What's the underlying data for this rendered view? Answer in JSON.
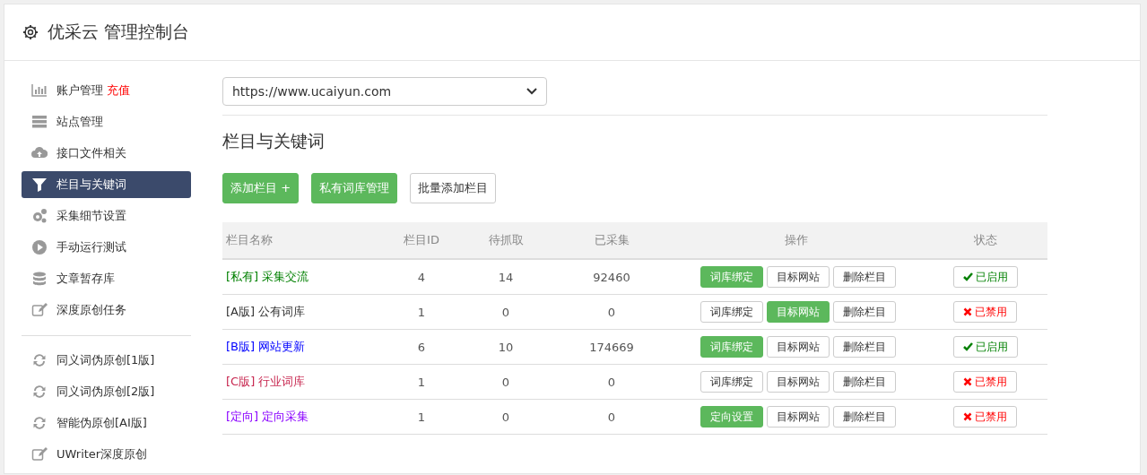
{
  "header": {
    "title": "优采云 管理控制台"
  },
  "sidebar": {
    "groups": [
      {
        "items": [
          {
            "label": "账户管理",
            "badge": "充值",
            "selected": false
          },
          {
            "label": "站点管理",
            "selected": false
          },
          {
            "label": "接口文件相关",
            "selected": false
          },
          {
            "label": "栏目与关键词",
            "selected": true
          },
          {
            "label": "采集细节设置",
            "selected": false
          },
          {
            "label": "手动运行测试",
            "selected": false
          },
          {
            "label": "文章暂存库",
            "selected": false
          },
          {
            "label": "深度原创任务",
            "selected": false
          }
        ]
      },
      {
        "items": [
          {
            "label": "同义词伪原创[1版]",
            "selected": false
          },
          {
            "label": "同义词伪原创[2版]",
            "selected": false
          },
          {
            "label": "智能伪原创[AI版]",
            "selected": false
          },
          {
            "label": "UWriter深度原创",
            "selected": false
          }
        ]
      }
    ]
  },
  "site_select": {
    "value": "https://www.ucaiyun.com"
  },
  "section_title": "栏目与关键词",
  "toolbar": [
    {
      "label": "添加栏目 +",
      "primary": true
    },
    {
      "label": "私有词库管理",
      "primary": true
    },
    {
      "label": "批量添加栏目",
      "primary": false
    }
  ],
  "table": {
    "columns": [
      "栏目名称",
      "栏目ID",
      "待抓取",
      "已采集",
      "操作",
      "状态"
    ],
    "rows": [
      {
        "name": "[私有] 采集交流",
        "color": "#008000",
        "id": "4",
        "pending": "14",
        "collected": "92460",
        "actions": [
          {
            "label": "词库绑定",
            "primary": true
          },
          {
            "label": "目标网站",
            "primary": false
          },
          {
            "label": "删除栏目",
            "primary": false
          }
        ],
        "enabled": true,
        "status": "已启用"
      },
      {
        "name": "[A版] 公有词库",
        "color": "#333333",
        "id": "1",
        "pending": "0",
        "collected": "0",
        "actions": [
          {
            "label": "词库绑定",
            "primary": false
          },
          {
            "label": "目标网站",
            "primary": true
          },
          {
            "label": "删除栏目",
            "primary": false
          }
        ],
        "enabled": false,
        "status": "已禁用"
      },
      {
        "name": "[B版] 网站更新",
        "color": "#0000ff",
        "id": "6",
        "pending": "10",
        "collected": "174669",
        "actions": [
          {
            "label": "词库绑定",
            "primary": true
          },
          {
            "label": "目标网站",
            "primary": false
          },
          {
            "label": "删除栏目",
            "primary": false
          }
        ],
        "enabled": true,
        "status": "已启用"
      },
      {
        "name": "[C版] 行业词库",
        "color": "#c7254e",
        "id": "1",
        "pending": "0",
        "collected": "0",
        "actions": [
          {
            "label": "词库绑定",
            "primary": false
          },
          {
            "label": "目标网站",
            "primary": false
          },
          {
            "label": "删除栏目",
            "primary": false
          }
        ],
        "enabled": false,
        "status": "已禁用"
      },
      {
        "name": "[定向] 定向采集",
        "color": "#8a00ff",
        "id": "1",
        "pending": "0",
        "collected": "0",
        "actions": [
          {
            "label": "定向设置",
            "primary": true
          },
          {
            "label": "目标网站",
            "primary": false
          },
          {
            "label": "删除栏目",
            "primary": false
          }
        ],
        "enabled": false,
        "status": "已禁用"
      }
    ]
  }
}
